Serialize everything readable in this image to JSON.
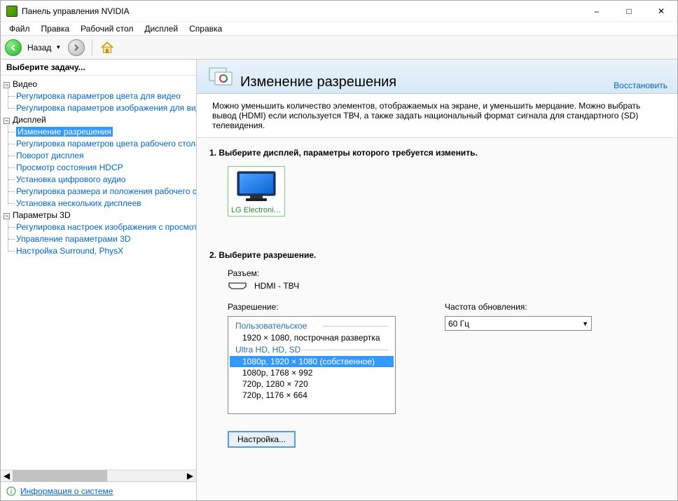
{
  "window": {
    "title": "Панель управления NVIDIA"
  },
  "menu": {
    "file": "Файл",
    "edit": "Правка",
    "desktop": "Рабочий стол",
    "display": "Дисплей",
    "help": "Справка"
  },
  "toolbar": {
    "back": "Назад"
  },
  "sidebar": {
    "header": "Выберите задачу...",
    "video_cat": "Видео",
    "video": [
      "Регулировка параметров цвета для видео",
      "Регулировка параметров изображения для видео"
    ],
    "display_cat": "Дисплей",
    "display": [
      "Изменение разрешения",
      "Регулировка параметров цвета рабочего стола",
      "Поворот дисплея",
      "Просмотр состояния HDCP",
      "Установка цифрового аудио",
      "Регулировка размера и положения рабочего стола",
      "Установка нескольких дисплеев"
    ],
    "p3d_cat": "Параметры 3D",
    "p3d": [
      "Регулировка настроек изображения с просмотром",
      "Управление параметрами 3D",
      "Настройка Surround, PhysX"
    ],
    "sysinfo": "Информация о системе"
  },
  "page": {
    "title": "Изменение разрешения",
    "restore": "Восстановить",
    "description": "Можно уменьшить количество элементов, отображаемых на экране, и уменьшить мерцание. Можно выбрать вывод (HDMI) если используется ТВЧ, а также задать национальный формат сигнала для стандартного (SD) телевидения."
  },
  "step1": {
    "label": "1. Выберите дисплей, параметры которого требуется изменить.",
    "display_name": "LG Electronics..."
  },
  "step2": {
    "label": "2. Выберите разрешение.",
    "connector_label": "Разъем:",
    "connector_value": "HDMI - ТВЧ",
    "resolution_label": "Разрешение:",
    "refresh_label": "Частота обновления:",
    "refresh_value": "60 Гц",
    "group_custom": "Пользовательское",
    "custom_items": [
      "1920 × 1080, построчная развертка"
    ],
    "group_uhd": "Ultra HD, HD, SD",
    "uhd_items": [
      "1080p, 1920 × 1080 (собственное)",
      "1080p, 1768 × 992",
      "720p, 1280 × 720",
      "720p, 1176 × 664"
    ],
    "custom_button": "Настройка..."
  }
}
